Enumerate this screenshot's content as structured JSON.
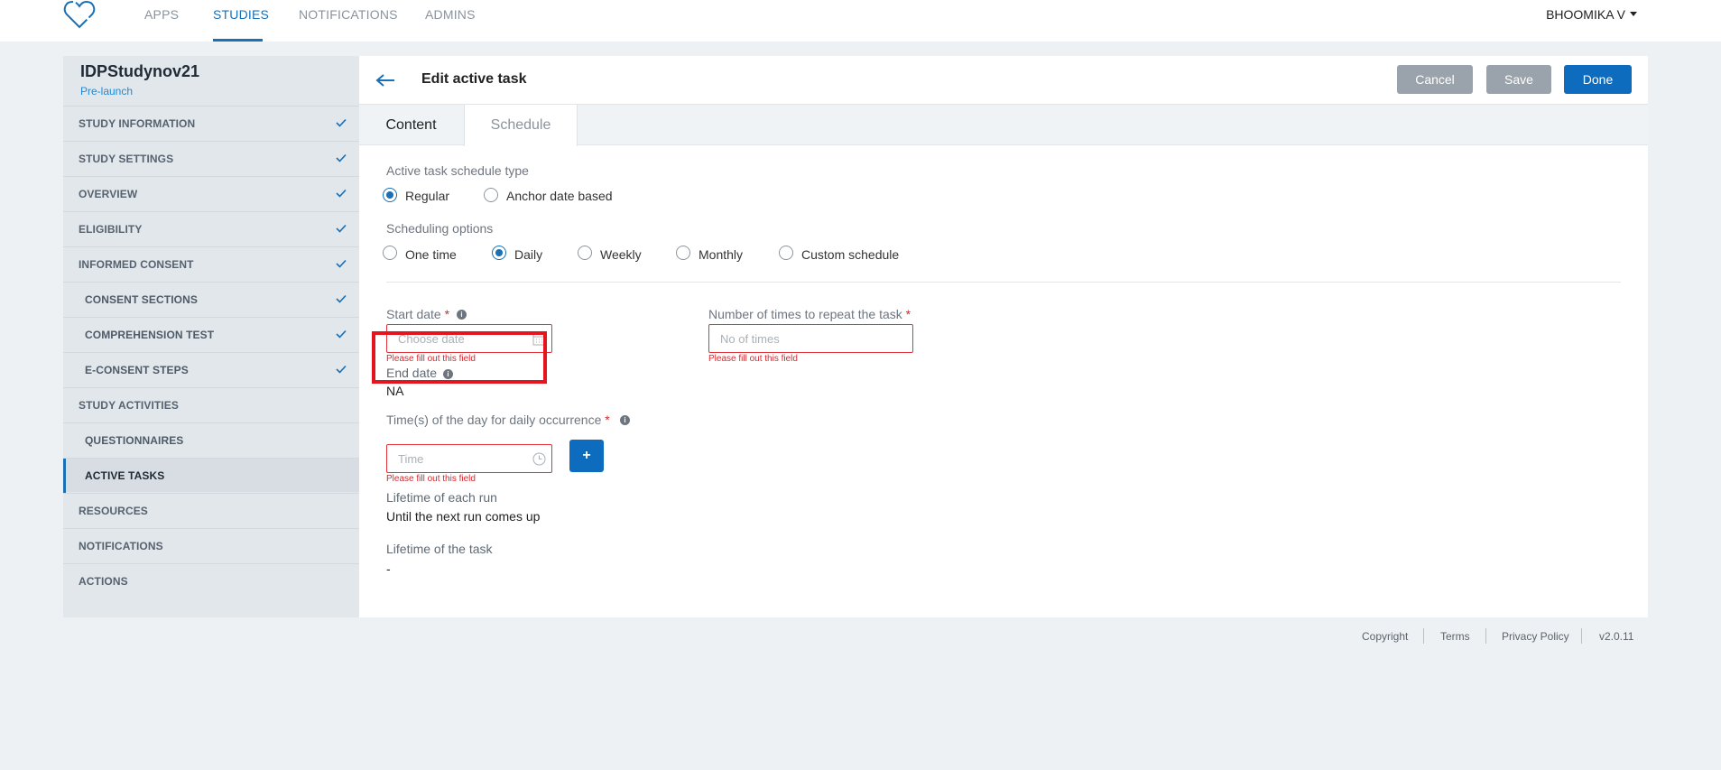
{
  "nav": {
    "links": [
      "APPS",
      "STUDIES",
      "NOTIFICATIONS",
      "ADMINS"
    ],
    "user": "BHOOMIKA V"
  },
  "sidebar": {
    "study_title": "IDPStudynov21",
    "study_status": "Pre-launch",
    "items": [
      {
        "label": "STUDY INFORMATION",
        "checked": true
      },
      {
        "label": "STUDY SETTINGS",
        "checked": true
      },
      {
        "label": "OVERVIEW",
        "checked": true
      },
      {
        "label": "ELIGIBILITY",
        "checked": true
      },
      {
        "label": "INFORMED CONSENT",
        "checked": true
      },
      {
        "label": "CONSENT SECTIONS",
        "checked": true
      },
      {
        "label": "COMPREHENSION TEST",
        "checked": true
      },
      {
        "label": "E-CONSENT STEPS",
        "checked": true
      },
      {
        "label": "STUDY ACTIVITIES",
        "checked": false
      },
      {
        "label": "QUESTIONNAIRES",
        "checked": false
      },
      {
        "label": "ACTIVE TASKS",
        "checked": false,
        "active": true
      },
      {
        "label": "RESOURCES",
        "checked": false
      },
      {
        "label": "NOTIFICATIONS",
        "checked": false
      },
      {
        "label": "ACTIONS",
        "checked": false
      }
    ]
  },
  "header": {
    "title": "Edit active task",
    "cancel_label": "Cancel",
    "save_label": "Save",
    "done_label": "Done"
  },
  "tabs": [
    "Content",
    "Schedule"
  ],
  "form": {
    "schedule_type_label": "Active task schedule type",
    "schedule_types": [
      {
        "label": "Regular",
        "selected": true
      },
      {
        "label": "Anchor date based",
        "selected": false
      }
    ],
    "scheduling_options_label": "Scheduling options",
    "scheduling_options": [
      {
        "label": "One time",
        "selected": false
      },
      {
        "label": "Daily",
        "selected": true
      },
      {
        "label": "Weekly",
        "selected": false
      },
      {
        "label": "Monthly",
        "selected": false
      },
      {
        "label": "Custom schedule",
        "selected": false
      }
    ],
    "start_date_label": "Start date",
    "start_date_placeholder": "Choose date",
    "start_date_error": "Please fill out this field",
    "repeat_label": "Number of times to repeat the task",
    "repeat_placeholder": "No of times",
    "repeat_error": "Please fill out this field",
    "end_date_label": "End date",
    "end_date_value": "NA",
    "times_label": "Time(s) of the day for daily occurrence",
    "time_placeholder": "Time",
    "time_error": "Please fill out this field",
    "add_time_label": "+",
    "required_mark": "*",
    "info_mark": "i",
    "lifetime_run_label": "Lifetime of each run",
    "lifetime_run_value": "Until the next run comes up",
    "lifetime_task_label": "Lifetime of the task",
    "lifetime_task_value": "-"
  },
  "footer": {
    "copyright": "Copyright",
    "terms": "Terms",
    "privacy": "Privacy Policy",
    "version": "v2.0.11"
  },
  "colors": {
    "brand": "#0d6cbd",
    "error": "#e0353b",
    "highlight": "#e3161f"
  }
}
